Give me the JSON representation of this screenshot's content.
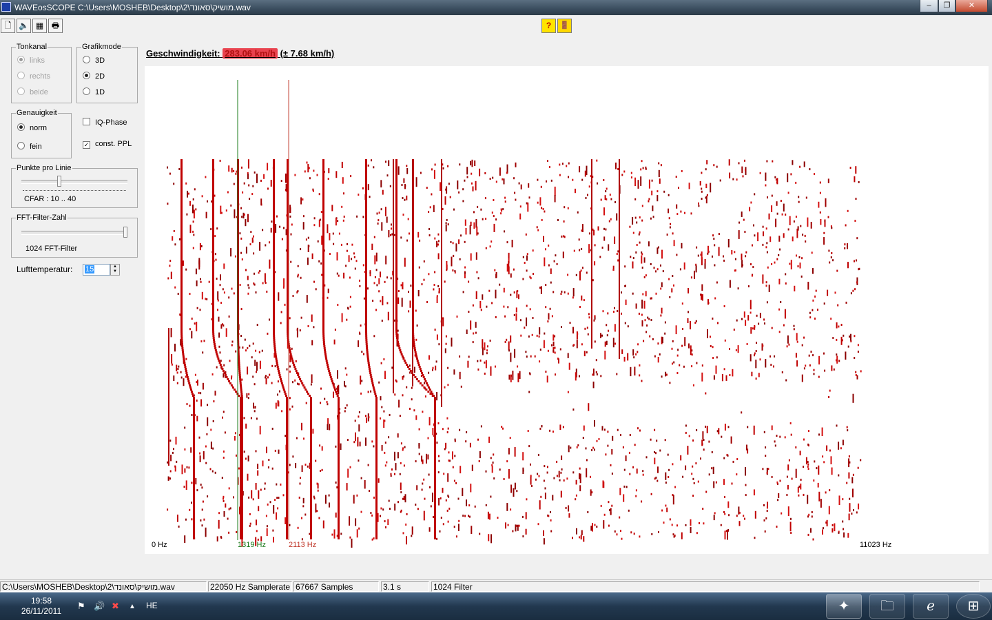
{
  "window": {
    "title": "WAVEosSCOPE  C:\\Users\\MOSHEB\\Desktop\\2\\מושיק\\סאונד.wav"
  },
  "toolbar": {
    "buttons": [
      {
        "name": "open-file-icon",
        "glyph": "🗋"
      },
      {
        "name": "speaker-icon",
        "glyph": "🔈"
      },
      {
        "name": "graph-icon",
        "glyph": "▦"
      },
      {
        "name": "print-icon",
        "glyph": "🖶"
      }
    ],
    "help_glyph": "?",
    "exit_glyph": "🚪"
  },
  "tonkanal": {
    "legend": "Tonkanal",
    "options": [
      "links",
      "rechts",
      "beide"
    ],
    "selected": 0,
    "disabled": true
  },
  "grafikmode": {
    "legend": "Grafikmode",
    "options": [
      "3D",
      "2D",
      "1D"
    ],
    "selected": 1
  },
  "genauigkeit": {
    "legend": "Genauigkeit",
    "options": [
      "norm",
      "fein"
    ],
    "selected": 0
  },
  "iq_phase": {
    "label": "IQ-Phase",
    "checked": false
  },
  "const_ppl": {
    "label": "const. PPL",
    "checked": true
  },
  "punkte": {
    "legend": "Punkte pro Linie",
    "caption": "CFAR : 10 .. 40"
  },
  "fft": {
    "legend": "FFT-Filter-Zahl",
    "caption": "1024 FFT-Filter"
  },
  "lufttemperatur": {
    "label": "Lufttemperatur:",
    "value": "15"
  },
  "speed": {
    "label": "Geschwindigkeit:",
    "value": "283.06 km/h",
    "tolerance": " (± 7.68 km/h)"
  },
  "plot": {
    "x_min_label": "0 Hz",
    "x_max_label": "11023 Hz",
    "x_max_hz": 11023,
    "marker_green": {
      "hz": 1319,
      "label": "1319 Hz",
      "color": "#1a7a1a"
    },
    "marker_red": {
      "hz": 2113,
      "label": "2113 Hz",
      "color": "#c0392b"
    },
    "trace_color": "#c00000"
  },
  "statusbar": {
    "path": "C:\\Users\\MOSHEB\\Desktop\\2\\מושיק\\סאונד.wav",
    "samplerate": "22050 Hz Samplerate",
    "samples": "67667 Samples",
    "duration": "3.1 s",
    "filter": "1024 Filter"
  },
  "taskbar": {
    "time": "19:58",
    "date": "26/11/2011",
    "lang": "HE"
  }
}
